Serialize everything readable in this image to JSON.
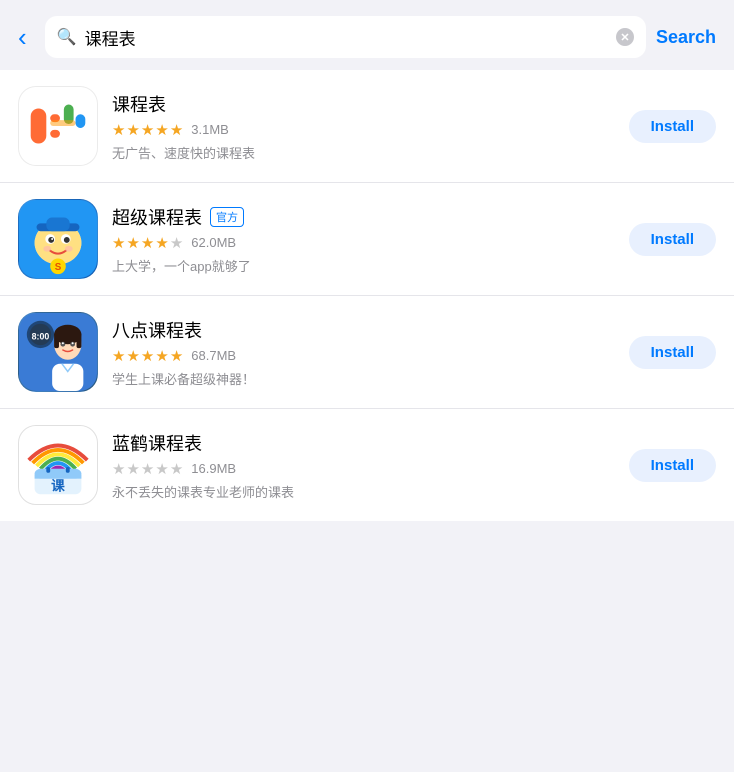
{
  "header": {
    "back_label": "‹",
    "search_query": "课程表",
    "search_button_label": "Search",
    "clear_button_aria": "clear"
  },
  "apps": [
    {
      "id": "kechengbiao",
      "name": "课程表",
      "official": false,
      "rating": 4.5,
      "rating_display": "4.5",
      "size": "3.1MB",
      "desc": "无广告、速度快的课程表",
      "install_label": "Install"
    },
    {
      "id": "super-kechengbiao",
      "name": "超级课程表",
      "official": true,
      "official_badge": "官方",
      "rating": 4.0,
      "rating_display": "4.0",
      "size": "62.0MB",
      "desc": "上大学，一个app就够了",
      "install_label": "Install"
    },
    {
      "id": "badian-kechengbiao",
      "name": "八点课程表",
      "official": false,
      "rating": 5.0,
      "rating_display": "5.0",
      "size": "68.7MB",
      "desc": "学生上课必备超级神器！",
      "install_label": "Install"
    },
    {
      "id": "lanhe-kechengbiao",
      "name": "蓝鹤课程表",
      "official": false,
      "rating": 0,
      "rating_display": "0",
      "size": "16.9MB",
      "desc": "永不丢失的课表专业老师的课表",
      "install_label": "Install"
    }
  ],
  "colors": {
    "accent": "#007aff",
    "star": "#f5a623",
    "install_bg": "#e8f0fe",
    "text_secondary": "#8e8e93"
  }
}
